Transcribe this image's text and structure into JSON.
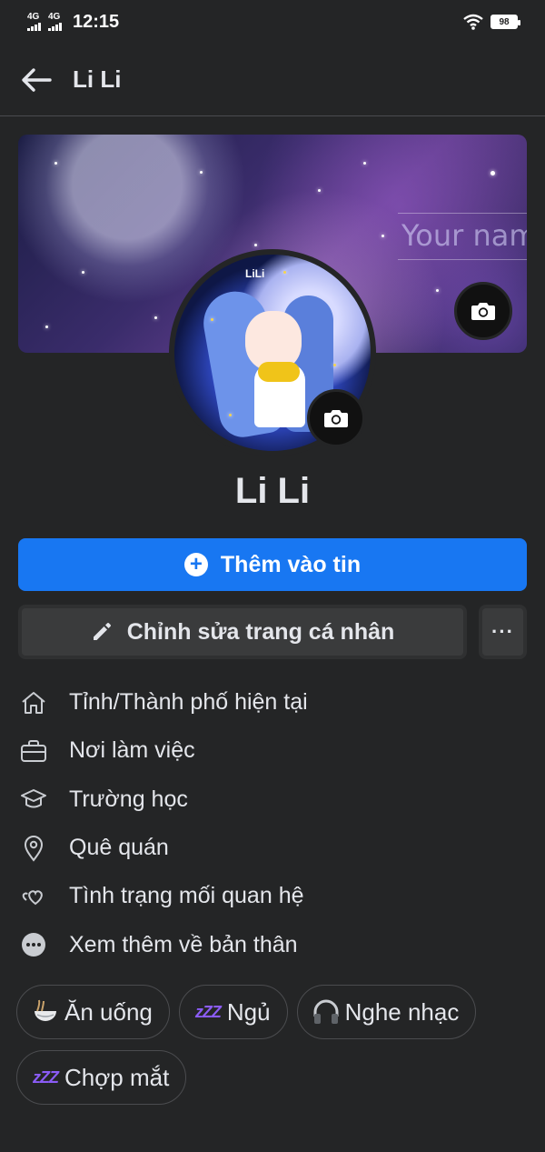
{
  "status_bar": {
    "signal_1": "4G",
    "signal_2": "4G",
    "time": "12:15",
    "battery": "98"
  },
  "header": {
    "back_icon": "arrow-left-icon",
    "title": "Li Li"
  },
  "cover": {
    "overlay_text": "Your nam",
    "camera_icon": "camera-icon"
  },
  "avatar": {
    "label": "LiLi",
    "camera_icon": "camera-icon"
  },
  "profile": {
    "name": "Li Li"
  },
  "actions": {
    "add_story_label": "Thêm vào tin",
    "edit_profile_label": "Chỉnh sửa trang cá nhân",
    "more_label": "···"
  },
  "details": [
    {
      "icon": "home-icon",
      "label": "Tỉnh/Thành phố hiện tại"
    },
    {
      "icon": "briefcase-icon",
      "label": "Nơi làm việc"
    },
    {
      "icon": "graduation-cap-icon",
      "label": "Trường học"
    },
    {
      "icon": "location-pin-icon",
      "label": "Quê quán"
    },
    {
      "icon": "hearts-icon",
      "label": "Tình trạng mối quan hệ"
    },
    {
      "icon": "more-circle-icon",
      "label": "Xem thêm về bản thân"
    }
  ],
  "hobbies": [
    {
      "icon": "noodle-bowl-icon",
      "label": "Ăn uống"
    },
    {
      "icon": "zzz-icon",
      "label": "Ngủ"
    },
    {
      "icon": "headphones-icon",
      "label": "Nghe nhạc"
    },
    {
      "icon": "zzz-icon",
      "label": "Chợp mắt"
    }
  ],
  "colors": {
    "background": "#242526",
    "primary": "#1877f2",
    "secondary_button": "#3a3b3c",
    "text": "#e4e6eb"
  }
}
